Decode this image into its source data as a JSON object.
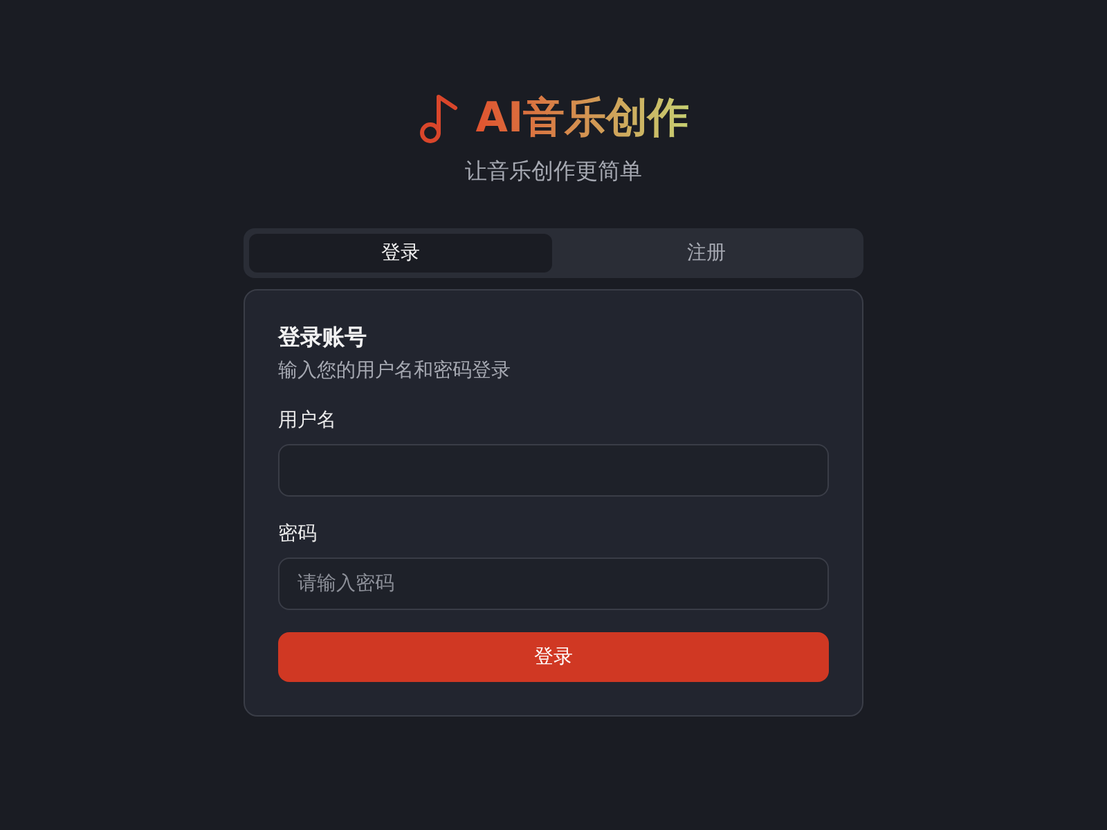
{
  "brand": {
    "title": "AI音乐创作",
    "subtitle": "让音乐创作更简单"
  },
  "tabs": [
    {
      "label": "登录",
      "selected": true
    },
    {
      "label": "注册",
      "selected": false
    }
  ],
  "form": {
    "title": "登录账号",
    "description": "输入您的用户名和密码登录",
    "fields": [
      {
        "label": "用户名"
      },
      {
        "label": "密码",
        "placeholder": "请输入密码"
      }
    ],
    "submit": "登录"
  }
}
